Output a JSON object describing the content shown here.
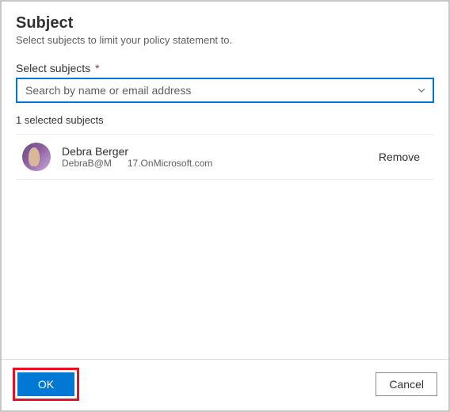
{
  "header": {
    "title": "Subject",
    "subtitle": "Select subjects to limit your policy statement to."
  },
  "field": {
    "label": "Select subjects",
    "required_marker": "*",
    "placeholder": "Search by name or email address"
  },
  "selected_count_text": "1 selected subjects",
  "subjects": [
    {
      "name": "Debra Berger",
      "email_part1": "DebraB@M",
      "email_part2": "17.OnMicrosoft.com",
      "remove_label": "Remove"
    }
  ],
  "footer": {
    "ok_label": "OK",
    "cancel_label": "Cancel"
  }
}
